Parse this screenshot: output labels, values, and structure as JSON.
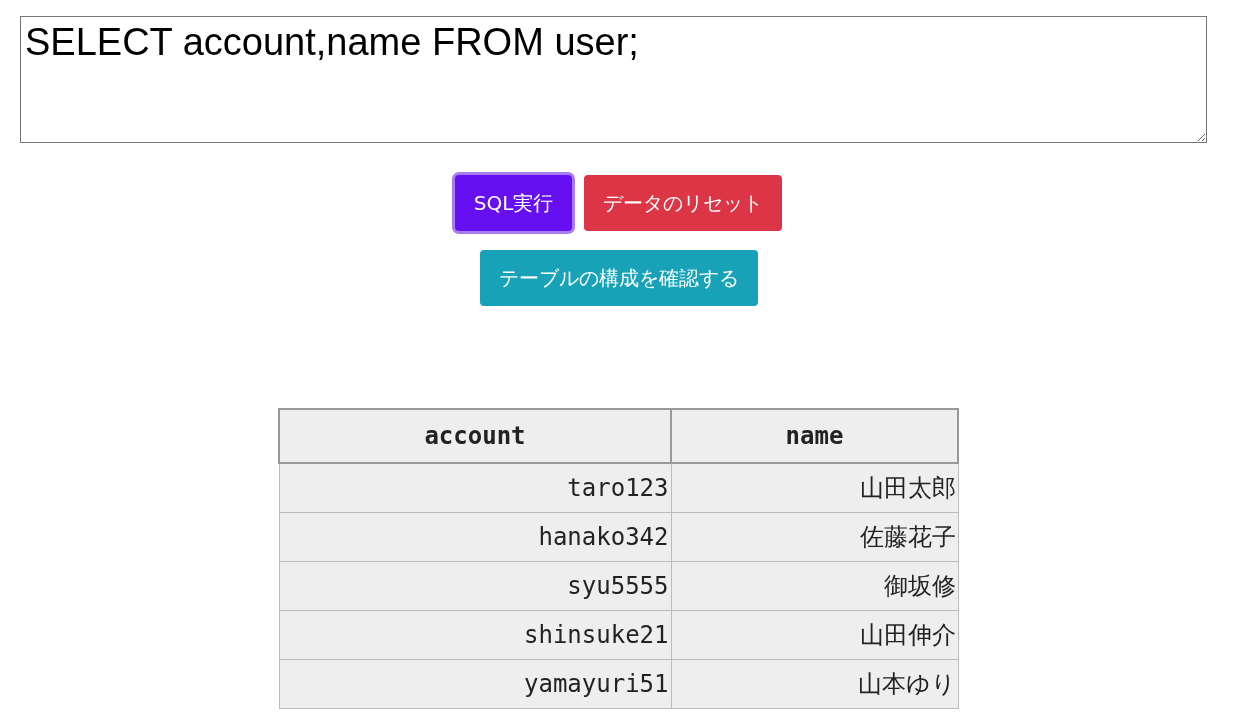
{
  "query_editor": {
    "value": "SELECT account,name FROM user;"
  },
  "buttons": [
    {
      "label": "SQL実行",
      "kind": "primary",
      "focused": true
    },
    {
      "label": "データのリセット",
      "kind": "danger",
      "focused": false
    }
  ],
  "secondary_buttons": [
    {
      "label": "テーブルの構成を確認する",
      "kind": "info",
      "focused": false
    }
  ],
  "table": {
    "columns": [
      "account",
      "name"
    ],
    "rows": [
      [
        "taro123",
        "山田太郎"
      ],
      [
        "hanako342",
        "佐藤花子"
      ],
      [
        "syu5555",
        "御坂修"
      ],
      [
        "shinsuke21",
        "山田伸介"
      ],
      [
        "yamayuri51",
        "山本ゆり"
      ]
    ]
  }
}
